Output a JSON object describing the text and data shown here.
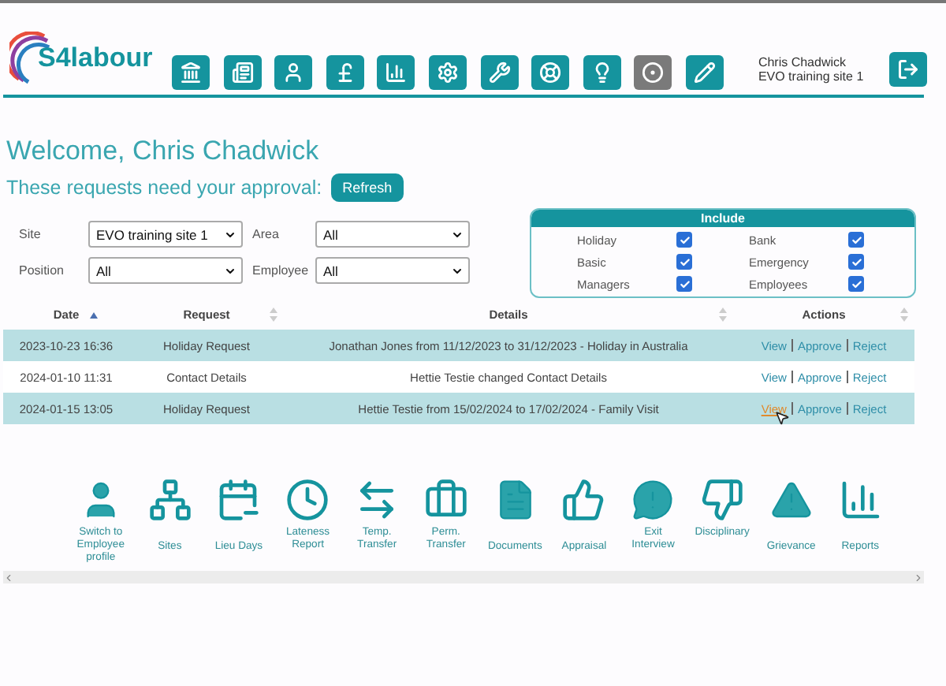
{
  "header": {
    "logo": "S4labour",
    "nav_tiles": [
      {
        "active": false
      },
      {
        "active": false
      },
      {
        "active": false
      },
      {
        "active": false
      },
      {
        "active": false
      },
      {
        "active": false
      },
      {
        "active": false
      },
      {
        "active": false
      },
      {
        "active": false
      },
      {
        "active": true
      },
      {
        "active": false
      }
    ],
    "user_name": "Chris Chadwick",
    "user_site": "EVO training site 1"
  },
  "welcome": "Welcome, Chris Chadwick",
  "approval_prompt": "These requests need your approval:",
  "refresh_button": "Refresh",
  "filters": [
    {
      "label": "Site",
      "value": "EVO training site 1"
    },
    {
      "label": "Area",
      "value": "All"
    },
    {
      "label": "Position",
      "value": "All"
    },
    {
      "label": "Employee",
      "value": "All"
    }
  ],
  "include": {
    "title": "Include",
    "options": [
      {
        "label": "Holiday",
        "checked": true
      },
      {
        "label": "Bank",
        "checked": true
      },
      {
        "label": "Basic",
        "checked": true
      },
      {
        "label": "Emergency",
        "checked": true
      },
      {
        "label": "Managers",
        "checked": true
      },
      {
        "label": "Employees",
        "checked": true
      }
    ]
  },
  "table": {
    "columns": [
      {
        "label": "Date",
        "sorted": true
      },
      {
        "label": "Request",
        "sorted": false
      },
      {
        "label": "Details",
        "sorted": false
      },
      {
        "label": "Actions",
        "sorted": false
      }
    ],
    "rows": [
      {
        "date": "2023-10-23 16:36",
        "request": "Holiday Request",
        "details": "Jonathan Jones from 11/12/2023 to 31/12/2023 - Holiday in Australia",
        "actions": [
          {
            "label": "View",
            "hovered": false
          },
          {
            "label": "Approve",
            "hovered": false
          },
          {
            "label": "Reject",
            "hovered": false
          }
        ]
      },
      {
        "date": "2024-01-10 11:31",
        "request": "Contact Details",
        "details": "Hettie Testie changed Contact Details",
        "actions": [
          {
            "label": "View",
            "hovered": false
          },
          {
            "label": "Approve",
            "hovered": false
          },
          {
            "label": "Reject",
            "hovered": false
          }
        ]
      },
      {
        "date": "2024-01-15 13:05",
        "request": "Holiday Request",
        "details": "Hettie Testie from 15/02/2024 to 17/02/2024 - Family Visit",
        "actions": [
          {
            "label": "View",
            "hovered": true
          },
          {
            "label": "Approve",
            "hovered": false
          },
          {
            "label": "Reject",
            "hovered": false
          }
        ]
      }
    ]
  },
  "shortcuts": [
    {
      "label": "Switch to Employee profile"
    },
    {
      "label": "Sites"
    },
    {
      "label": "Lieu Days"
    },
    {
      "label": "Lateness Report"
    },
    {
      "label": "Temp. Transfer"
    },
    {
      "label": "Perm. Transfer"
    },
    {
      "label": "Documents"
    },
    {
      "label": "Appraisal"
    },
    {
      "label": "Exit Interview"
    },
    {
      "label": "Disciplinary"
    },
    {
      "label": "Grievance"
    },
    {
      "label": "Reports"
    }
  ]
}
